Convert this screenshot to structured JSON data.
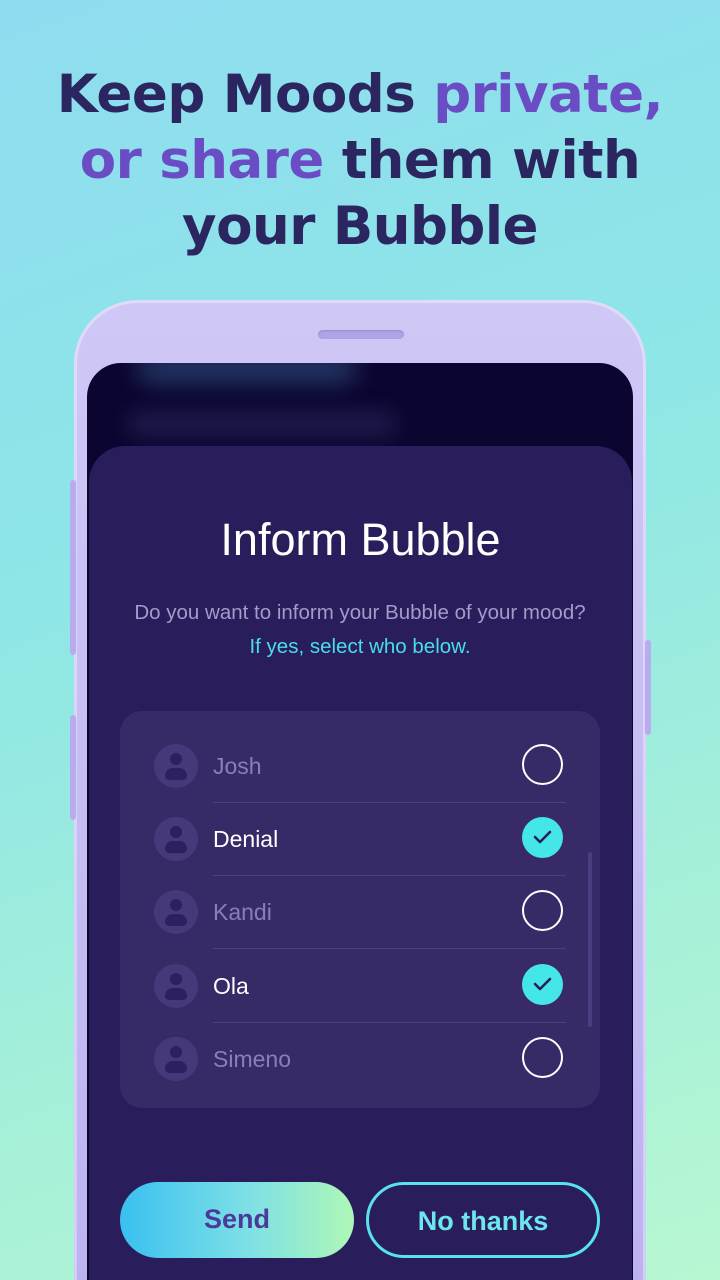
{
  "headline": {
    "line1_plain": "Keep Moods ",
    "line1_accent": "private,",
    "line2_accent": "or share",
    "line2_plain": " them with",
    "line3": "your Bubble"
  },
  "modal": {
    "title": "Inform Bubble",
    "description_plain": "Do you want to inform your Bubble of your mood? ",
    "description_accent": "If yes, select who below."
  },
  "contacts": [
    {
      "name": "Josh",
      "selected": false
    },
    {
      "name": "Denial",
      "selected": true
    },
    {
      "name": "Kandi",
      "selected": false
    },
    {
      "name": "Ola",
      "selected": true
    },
    {
      "name": "Simeno",
      "selected": false
    }
  ],
  "buttons": {
    "send": "Send",
    "no_thanks": "No thanks"
  },
  "colors": {
    "headline": "#2b2560",
    "headline_accent": "#6a4cc4",
    "sheet_bg": "#2a1d5b",
    "accent_cyan": "#49dcee",
    "checked": "#45e6e8"
  }
}
